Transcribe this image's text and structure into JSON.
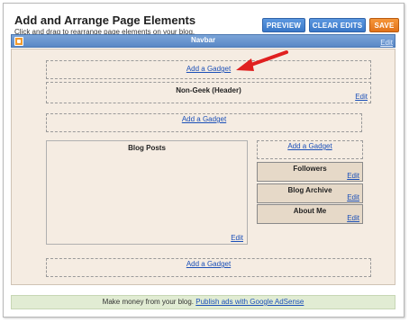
{
  "header": {
    "title": "Add and Arrange Page Elements",
    "subtitle": "Click and drag to rearrange page elements on your blog."
  },
  "toolbar": {
    "preview_label": "PREVIEW",
    "clear_edits_label": "CLEAR EDITS",
    "save_label": "SAVE"
  },
  "navbar": {
    "label": "Navbar",
    "edit_label": "Edit"
  },
  "layout": {
    "add_gadget_label": "Add a Gadget",
    "header_widget": {
      "title": "Non-Geek (Header)",
      "edit_label": "Edit"
    },
    "main_widget": {
      "title": "Blog Posts",
      "edit_label": "Edit"
    },
    "sidebar": [
      {
        "title": "Followers",
        "edit_label": "Edit"
      },
      {
        "title": "Blog Archive",
        "edit_label": "Edit"
      },
      {
        "title": "About Me",
        "edit_label": "Edit"
      }
    ]
  },
  "footer": {
    "text": "Make money from your blog.",
    "link_label": "Publish ads with Google AdSense"
  },
  "colors": {
    "accent_blue": "#3a78c8",
    "save_orange": "#e2731a",
    "canvas_bg": "#f5ece2",
    "widget_tan": "#e6d9c8",
    "annotation_arrow": "#e02020"
  },
  "icons": {
    "navbar_logo": "blogger-icon",
    "annotation": "red-arrow-icon"
  }
}
